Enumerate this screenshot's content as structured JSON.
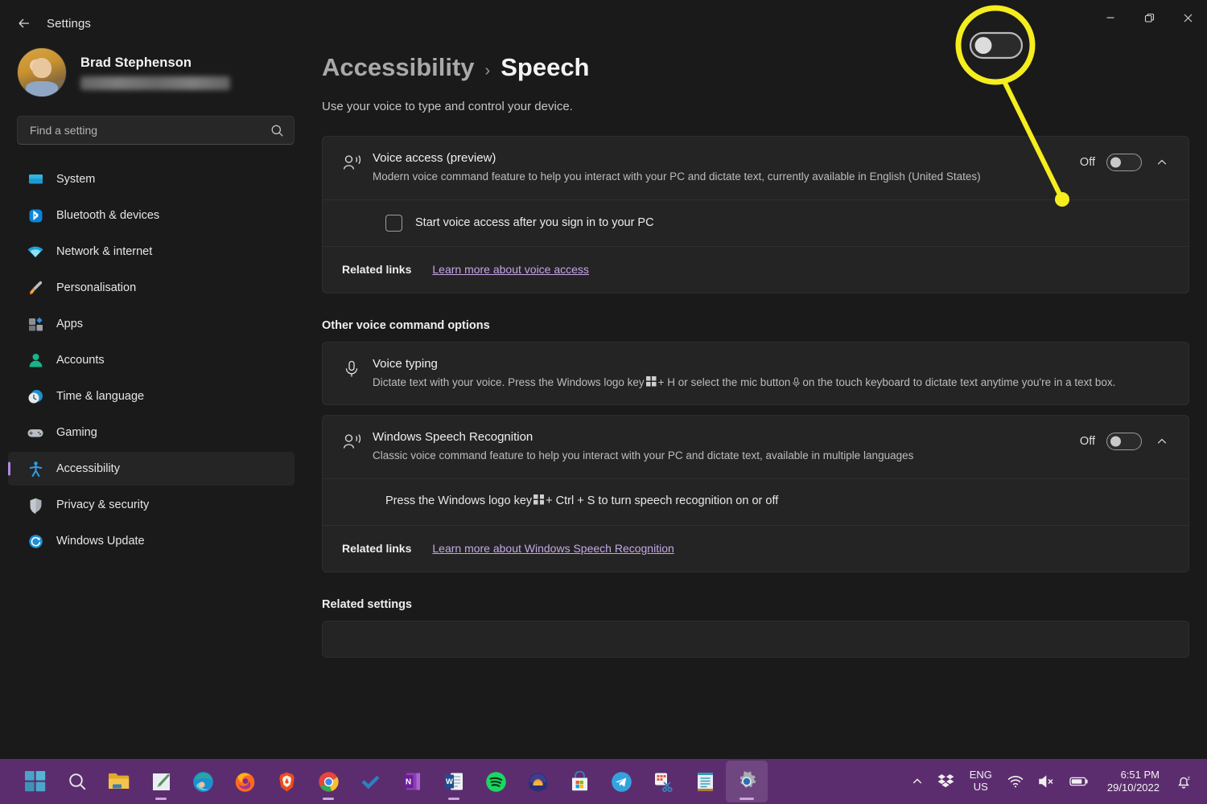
{
  "window": {
    "title": "Settings",
    "back_icon": "back-arrow-icon",
    "minimize_label": "Minimise",
    "restore_label": "Restore",
    "close_label": "Close"
  },
  "sidebar": {
    "profile": {
      "name": "Brad Stephenson",
      "email_redacted": ""
    },
    "search": {
      "placeholder": "Find a setting",
      "value": "",
      "icon": "search-icon"
    },
    "items": [
      {
        "label": "System",
        "icon": "system-icon",
        "selected": false
      },
      {
        "label": "Bluetooth & devices",
        "icon": "bluetooth-icon",
        "selected": false
      },
      {
        "label": "Network & internet",
        "icon": "wifi-icon",
        "selected": false
      },
      {
        "label": "Personalisation",
        "icon": "paintbrush-icon",
        "selected": false
      },
      {
        "label": "Apps",
        "icon": "apps-icon",
        "selected": false
      },
      {
        "label": "Accounts",
        "icon": "account-icon",
        "selected": false
      },
      {
        "label": "Time & language",
        "icon": "clock-globe-icon",
        "selected": false
      },
      {
        "label": "Gaming",
        "icon": "gamepad-icon",
        "selected": false
      },
      {
        "label": "Accessibility",
        "icon": "accessibility-icon",
        "selected": true
      },
      {
        "label": "Privacy & security",
        "icon": "shield-icon",
        "selected": false
      },
      {
        "label": "Windows Update",
        "icon": "update-icon",
        "selected": false
      }
    ]
  },
  "main": {
    "breadcrumb": {
      "parent": "Accessibility",
      "separator": "›",
      "current": "Speech"
    },
    "subtitle": "Use your voice to type and control your device.",
    "voice_access": {
      "title": "Voice access (preview)",
      "description": "Modern voice command feature to help you interact with your PC and dictate text, currently available in English (United States)",
      "state": "Off",
      "toggle_on": false,
      "icon": "voice-access-icon",
      "expand_icon": "chevron-up-icon",
      "checkbox": {
        "label": "Start voice access after you sign in to your PC",
        "checked": false
      },
      "related": {
        "label": "Related links",
        "link": "Learn more about voice access"
      }
    },
    "other_options_heading": "Other voice command options",
    "voice_typing": {
      "title": "Voice typing",
      "desc_part1": "Dictate text with your voice. Press the Windows logo key",
      "desc_part2": "+ H or select the mic button",
      "desc_part3": "on the touch keyboard to dictate text anytime you're in a text box.",
      "icon": "microphone-icon"
    },
    "speech_recognition": {
      "title": "Windows Speech Recognition",
      "description": "Classic voice command feature to help you interact with your PC and dictate text, available in multiple languages",
      "state": "Off",
      "toggle_on": false,
      "icon": "speech-recognition-icon",
      "expand_icon": "chevron-up-icon",
      "shortcut_part1": "Press the Windows logo key",
      "shortcut_part2": "+ Ctrl + S to turn speech recognition on or off",
      "related": {
        "label": "Related links",
        "link": "Learn more about Windows Speech Recognition"
      }
    },
    "related_settings_heading": "Related settings"
  },
  "annotation": {
    "color": "#f5ed1e",
    "magnified_control": "voice-access-toggle",
    "magnified_state": "Off"
  },
  "taskbar": {
    "background": "#5c2d6e",
    "apps": [
      {
        "name": "start-button",
        "label": "Start",
        "running": false,
        "active": false
      },
      {
        "name": "search-taskbar-icon",
        "label": "Search",
        "running": false,
        "active": false
      },
      {
        "name": "file-explorer-icon",
        "label": "File Explorer",
        "running": false,
        "active": false
      },
      {
        "name": "notepad-classic-icon",
        "label": "Writing app",
        "running": true,
        "active": false
      },
      {
        "name": "edge-icon",
        "label": "Microsoft Edge",
        "running": false,
        "active": false
      },
      {
        "name": "firefox-icon",
        "label": "Firefox",
        "running": false,
        "active": false
      },
      {
        "name": "brave-icon",
        "label": "Brave",
        "running": false,
        "active": false
      },
      {
        "name": "chrome-icon",
        "label": "Google Chrome",
        "running": true,
        "active": false
      },
      {
        "name": "todo-icon",
        "label": "Microsoft To Do",
        "running": false,
        "active": false
      },
      {
        "name": "onenote-icon",
        "label": "OneNote",
        "running": false,
        "active": false
      },
      {
        "name": "word-icon",
        "label": "Word",
        "running": true,
        "active": false
      },
      {
        "name": "spotify-icon",
        "label": "Spotify",
        "running": false,
        "active": false
      },
      {
        "name": "audacity-icon",
        "label": "Audacity",
        "running": false,
        "active": false
      },
      {
        "name": "microsoft-store-icon",
        "label": "Microsoft Store",
        "running": false,
        "active": false
      },
      {
        "name": "telegram-icon",
        "label": "Telegram",
        "running": false,
        "active": false
      },
      {
        "name": "snipping-tool-icon",
        "label": "Snipping Tool",
        "running": false,
        "active": false
      },
      {
        "name": "sticky-notes-icon",
        "label": "Notepad",
        "running": false,
        "active": false
      },
      {
        "name": "settings-icon",
        "label": "Settings",
        "running": true,
        "active": true
      }
    ],
    "tray": {
      "overflow_icon": "chevron-up-icon",
      "dropbox_icon": "dropbox-icon",
      "language_line1": "ENG",
      "language_line2": "US",
      "wifi_icon": "wifi-icon",
      "volume_icon": "volume-muted-icon",
      "battery_icon": "battery-icon",
      "time": "6:51 PM",
      "date": "29/10/2022",
      "notification_icon": "notification-dnd-icon"
    }
  }
}
